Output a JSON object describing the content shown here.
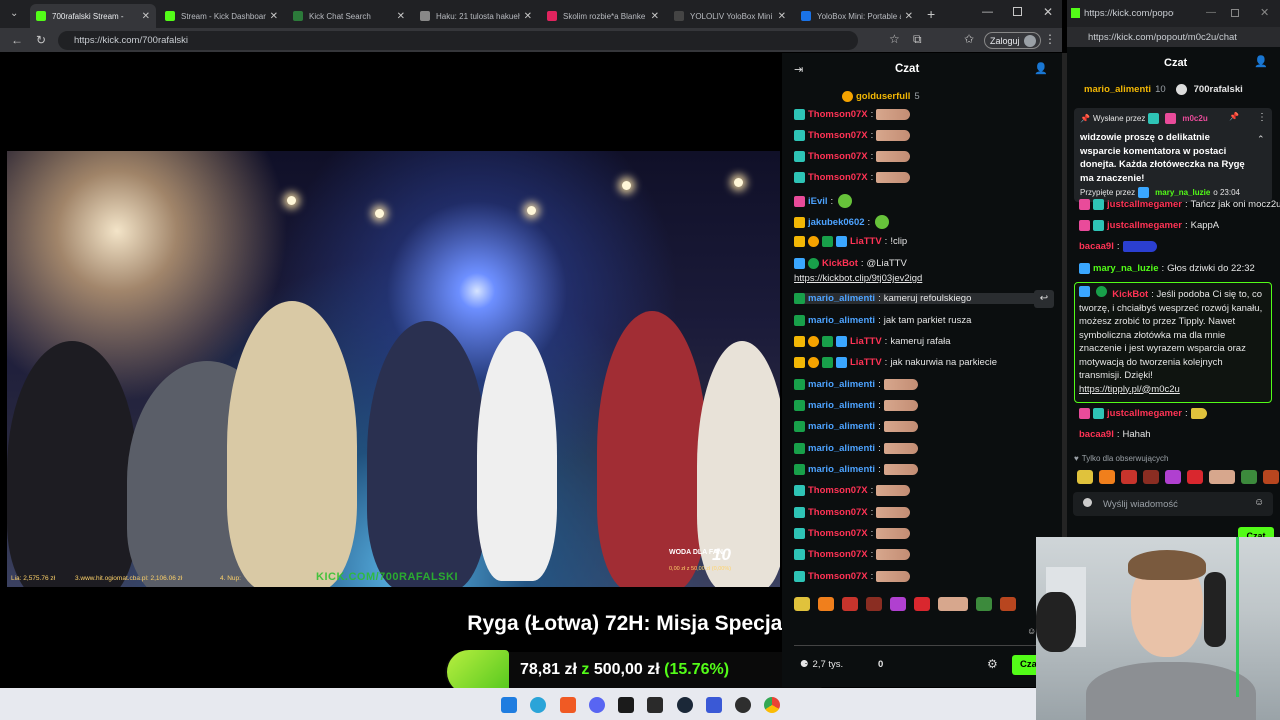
{
  "browser1": {
    "tabs": [
      {
        "label": "700rafalski Stream -",
        "active": true
      },
      {
        "label": "Stream - Kick Dashboard",
        "active": false
      },
      {
        "label": "Kick Chat Search",
        "active": false
      },
      {
        "label": "Haku: 21 tulosta hakueh",
        "active": false
      },
      {
        "label": "Skolim rozbie*a Blanke",
        "active": false
      },
      {
        "label": "YOLOLIV YoloBox Mini -",
        "active": false
      },
      {
        "label": "YoloBox Mini: Portable ar",
        "active": false
      }
    ],
    "url": "https://kick.com/700rafalski",
    "login_label": "Zaloguj"
  },
  "video": {
    "overlay_left": "Lia: 2,575.76 zł",
    "overlay_mid": "3.www.hit.ogiomat.cba.pl: 2,106.06 zł",
    "overlay_right": "4. Nup:",
    "overlay_kick": "KICK.COM/700RAFALSKI",
    "woda_label": "WODA DLA FAN",
    "woda_num": "10",
    "woda_small": "0,00 zł  z  50,00 zł  (0,00%)"
  },
  "mission": {
    "title": "Ryga (Łotwa) 72H: Misja Specjalna",
    "amount": "78,81 zł",
    "z": "z",
    "goal": "500,00 zł",
    "percent": "(15.76%)",
    "progress": 0.1576
  },
  "chat1": {
    "title": "Czat",
    "top_user": "golduserfull",
    "top_count": "5",
    "messages": [
      {
        "user": "Thomson07X",
        "color": "#ff3355",
        "text": "",
        "emote": true
      },
      {
        "user": "Thomson07X",
        "color": "#ff3355",
        "text": "",
        "emote": true
      },
      {
        "user": "Thomson07X",
        "color": "#ff3355",
        "text": "",
        "emote": true
      },
      {
        "user": "Thomson07X",
        "color": "#ff3355",
        "text": "",
        "emote": true
      },
      {
        "user": "iEvil",
        "color": "#4da3ff",
        "text": "",
        "emote": false
      },
      {
        "user": "jakubek0602",
        "color": "#4da3ff",
        "text": "",
        "emote": false
      },
      {
        "user": "LiaTTV",
        "color": "#ff3355",
        "text": "!clip",
        "emote": false
      },
      {
        "user": "KickBot",
        "color": "#ff3355",
        "text": "@LiaTTV",
        "emote": false
      },
      {
        "user": "mario_alimenti",
        "color": "#4da3ff",
        "text": "kameruj refoulskiego",
        "emote": false
      },
      {
        "user": "mario_alimenti",
        "color": "#4da3ff",
        "text": "jak tam parkiet rusza",
        "emote": false
      },
      {
        "user": "LiaTTV",
        "color": "#ff3355",
        "text": "kameruj rafała",
        "emote": false
      },
      {
        "user": "LiaTTV",
        "color": "#ff3355",
        "text": "jak nakurwia na parkiecie",
        "emote": false
      },
      {
        "user": "mario_alimenti",
        "color": "#4da3ff",
        "text": "",
        "emote": true
      },
      {
        "user": "mario_alimenti",
        "color": "#4da3ff",
        "text": "",
        "emote": true
      },
      {
        "user": "mario_alimenti",
        "color": "#4da3ff",
        "text": "",
        "emote": true
      },
      {
        "user": "mario_alimenti",
        "color": "#4da3ff",
        "text": "",
        "emote": true
      },
      {
        "user": "mario_alimenti",
        "color": "#4da3ff",
        "text": "",
        "emote": true
      },
      {
        "user": "Thomson07X",
        "color": "#ff3355",
        "text": "",
        "emote": true
      },
      {
        "user": "Thomson07X",
        "color": "#ff3355",
        "text": "",
        "emote": true
      },
      {
        "user": "Thomson07X",
        "color": "#ff3355",
        "text": "",
        "emote": true
      },
      {
        "user": "Thomson07X",
        "color": "#ff3355",
        "text": "",
        "emote": true
      },
      {
        "user": "Thomson07X",
        "color": "#ff3355",
        "text": "",
        "emote": true
      }
    ],
    "clip_link": "https://kickbot.clip/9tj03jev2igd",
    "viewers": "2,7 tys.",
    "zero": "0",
    "chat_button": "Cza"
  },
  "popout": {
    "url": "https://kick.com/popout/m0c2u/chat",
    "title": "Czat",
    "top_user1": "mario_alimenti",
    "top_user1_count": "10",
    "top_user2": "700rafalski",
    "pinned_by_label": "Wysłane przez",
    "pinned_user": "m0c2u",
    "pinned_text": "widzowie proszę o delikatnie wsparcie komentatora w postaci donejta. Każda złotóweczka na Rygę ma znaczenie!",
    "pinned_footer_label": "Przypięte przez",
    "pinned_footer_user": "mary_na_luzie",
    "pinned_footer_time": "o 23:04",
    "messages": [
      {
        "user": "justcallmegamer",
        "color": "#ff3355",
        "text": "Tańcz jak oni mocz2u"
      },
      {
        "user": "justcallmegamer",
        "color": "#ff3355",
        "text": "KappA"
      },
      {
        "user": "bacaa9l",
        "color": "#ff3355",
        "text": ""
      },
      {
        "user": "mary_na_luzie",
        "color": "#53fc18",
        "text": "Głos dziwki do 22:32"
      }
    ],
    "kickbot_user": "KickBot",
    "kickbot_text": "Jeśli podoba Ci się to, co tworzę, i chciałbyś wesprzeć rozwój kanału, możesz zrobić to przez Tipply. Nawet symboliczna złotówka ma dla mnie znaczenie i jest wyrazem wsparcia oraz motywacją do tworzenia kolejnych transmisji. Dzięki!",
    "kickbot_link": "https://tipply.pl/@m0c2u",
    "after": [
      {
        "user": "justcallmegamer",
        "color": "#ff3355",
        "text": ""
      },
      {
        "user": "bacaa9l",
        "color": "#ff3355",
        "text": "Hahah"
      }
    ],
    "followers_only": "Tylko dla obserwujących",
    "input_placeholder": "Wyślij wiadomość",
    "chat_button": "Czat"
  }
}
